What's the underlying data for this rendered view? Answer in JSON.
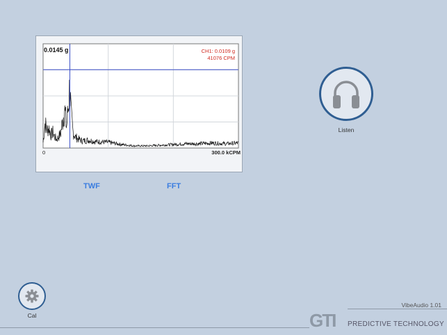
{
  "chart": {
    "y_label": "0.0145 g",
    "channel_readout": "CH1: 0.0109 g",
    "cpm_readout": "41076 CPM",
    "x_min_label": "0",
    "x_max_label": "300.0 kCPM"
  },
  "tabs": [
    {
      "label": "TWF"
    },
    {
      "label": "FFT"
    }
  ],
  "listen": {
    "label": "Listen",
    "icon": "headphones-icon"
  },
  "cal": {
    "label": "Cal",
    "icon": "gear-icon"
  },
  "footer": {
    "version": "VibeAudio 1.01",
    "logo_text": "GTI",
    "tagline": "PREDICTIVE TECHNOLOGY"
  },
  "colors": {
    "background": "#c3d0e0",
    "cursor": "#3b4fc7",
    "readout": "#d0281e",
    "tab": "#3a7de0",
    "button_ring": "#2f5e92"
  },
  "chart_data": {
    "type": "line",
    "xlabel": "",
    "ylabel": "",
    "x_unit": "kCPM",
    "xlim": [
      0,
      300
    ],
    "ylim": [
      0,
      0.0145
    ],
    "cursor": {
      "x": 41.076,
      "y": 0.0109
    },
    "series": [
      {
        "x": [
          0,
          3,
          6,
          9,
          12,
          15,
          18,
          21,
          24,
          27,
          30,
          33,
          36,
          39,
          41,
          43,
          46,
          50,
          55,
          60,
          70,
          80,
          100,
          120,
          140,
          160,
          180,
          200,
          220,
          240,
          260,
          280,
          300
        ],
        "values": [
          0.0008,
          0.0035,
          0.0025,
          0.0028,
          0.0018,
          0.0022,
          0.0015,
          0.0012,
          0.0016,
          0.002,
          0.0038,
          0.0055,
          0.0028,
          0.0062,
          0.0085,
          0.0045,
          0.0022,
          0.0015,
          0.0012,
          0.001,
          0.0011,
          0.0009,
          0.0008,
          0.0005,
          0.0003,
          0.0003,
          0.0004,
          0.0005,
          0.0006,
          0.0006,
          0.0007,
          0.0006,
          0.0007
        ]
      }
    ]
  }
}
